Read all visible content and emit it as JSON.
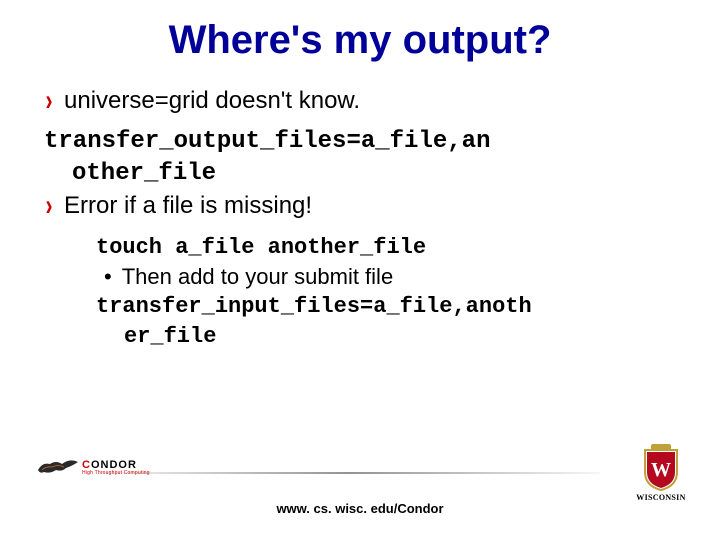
{
  "title": "Where's my output?",
  "bullets": {
    "b1": "universe=grid doesn't know.",
    "code1a": "transfer_output_files=a_file,an",
    "code1b": "other_file",
    "b2": "Error if a file is missing!",
    "sub_code1": "touch a_file another_file",
    "sub_bullet": "Then add to your submit file",
    "sub_code2a": "transfer_input_files=a_file,anoth",
    "sub_code2b": "er_file"
  },
  "footer": {
    "url": "www. cs. wisc. edu/Condor",
    "condor_c": "C",
    "condor_rest": "ONDOR",
    "condor_sub": "High Throughput Computing",
    "wisconsin": "WISCONSIN"
  }
}
